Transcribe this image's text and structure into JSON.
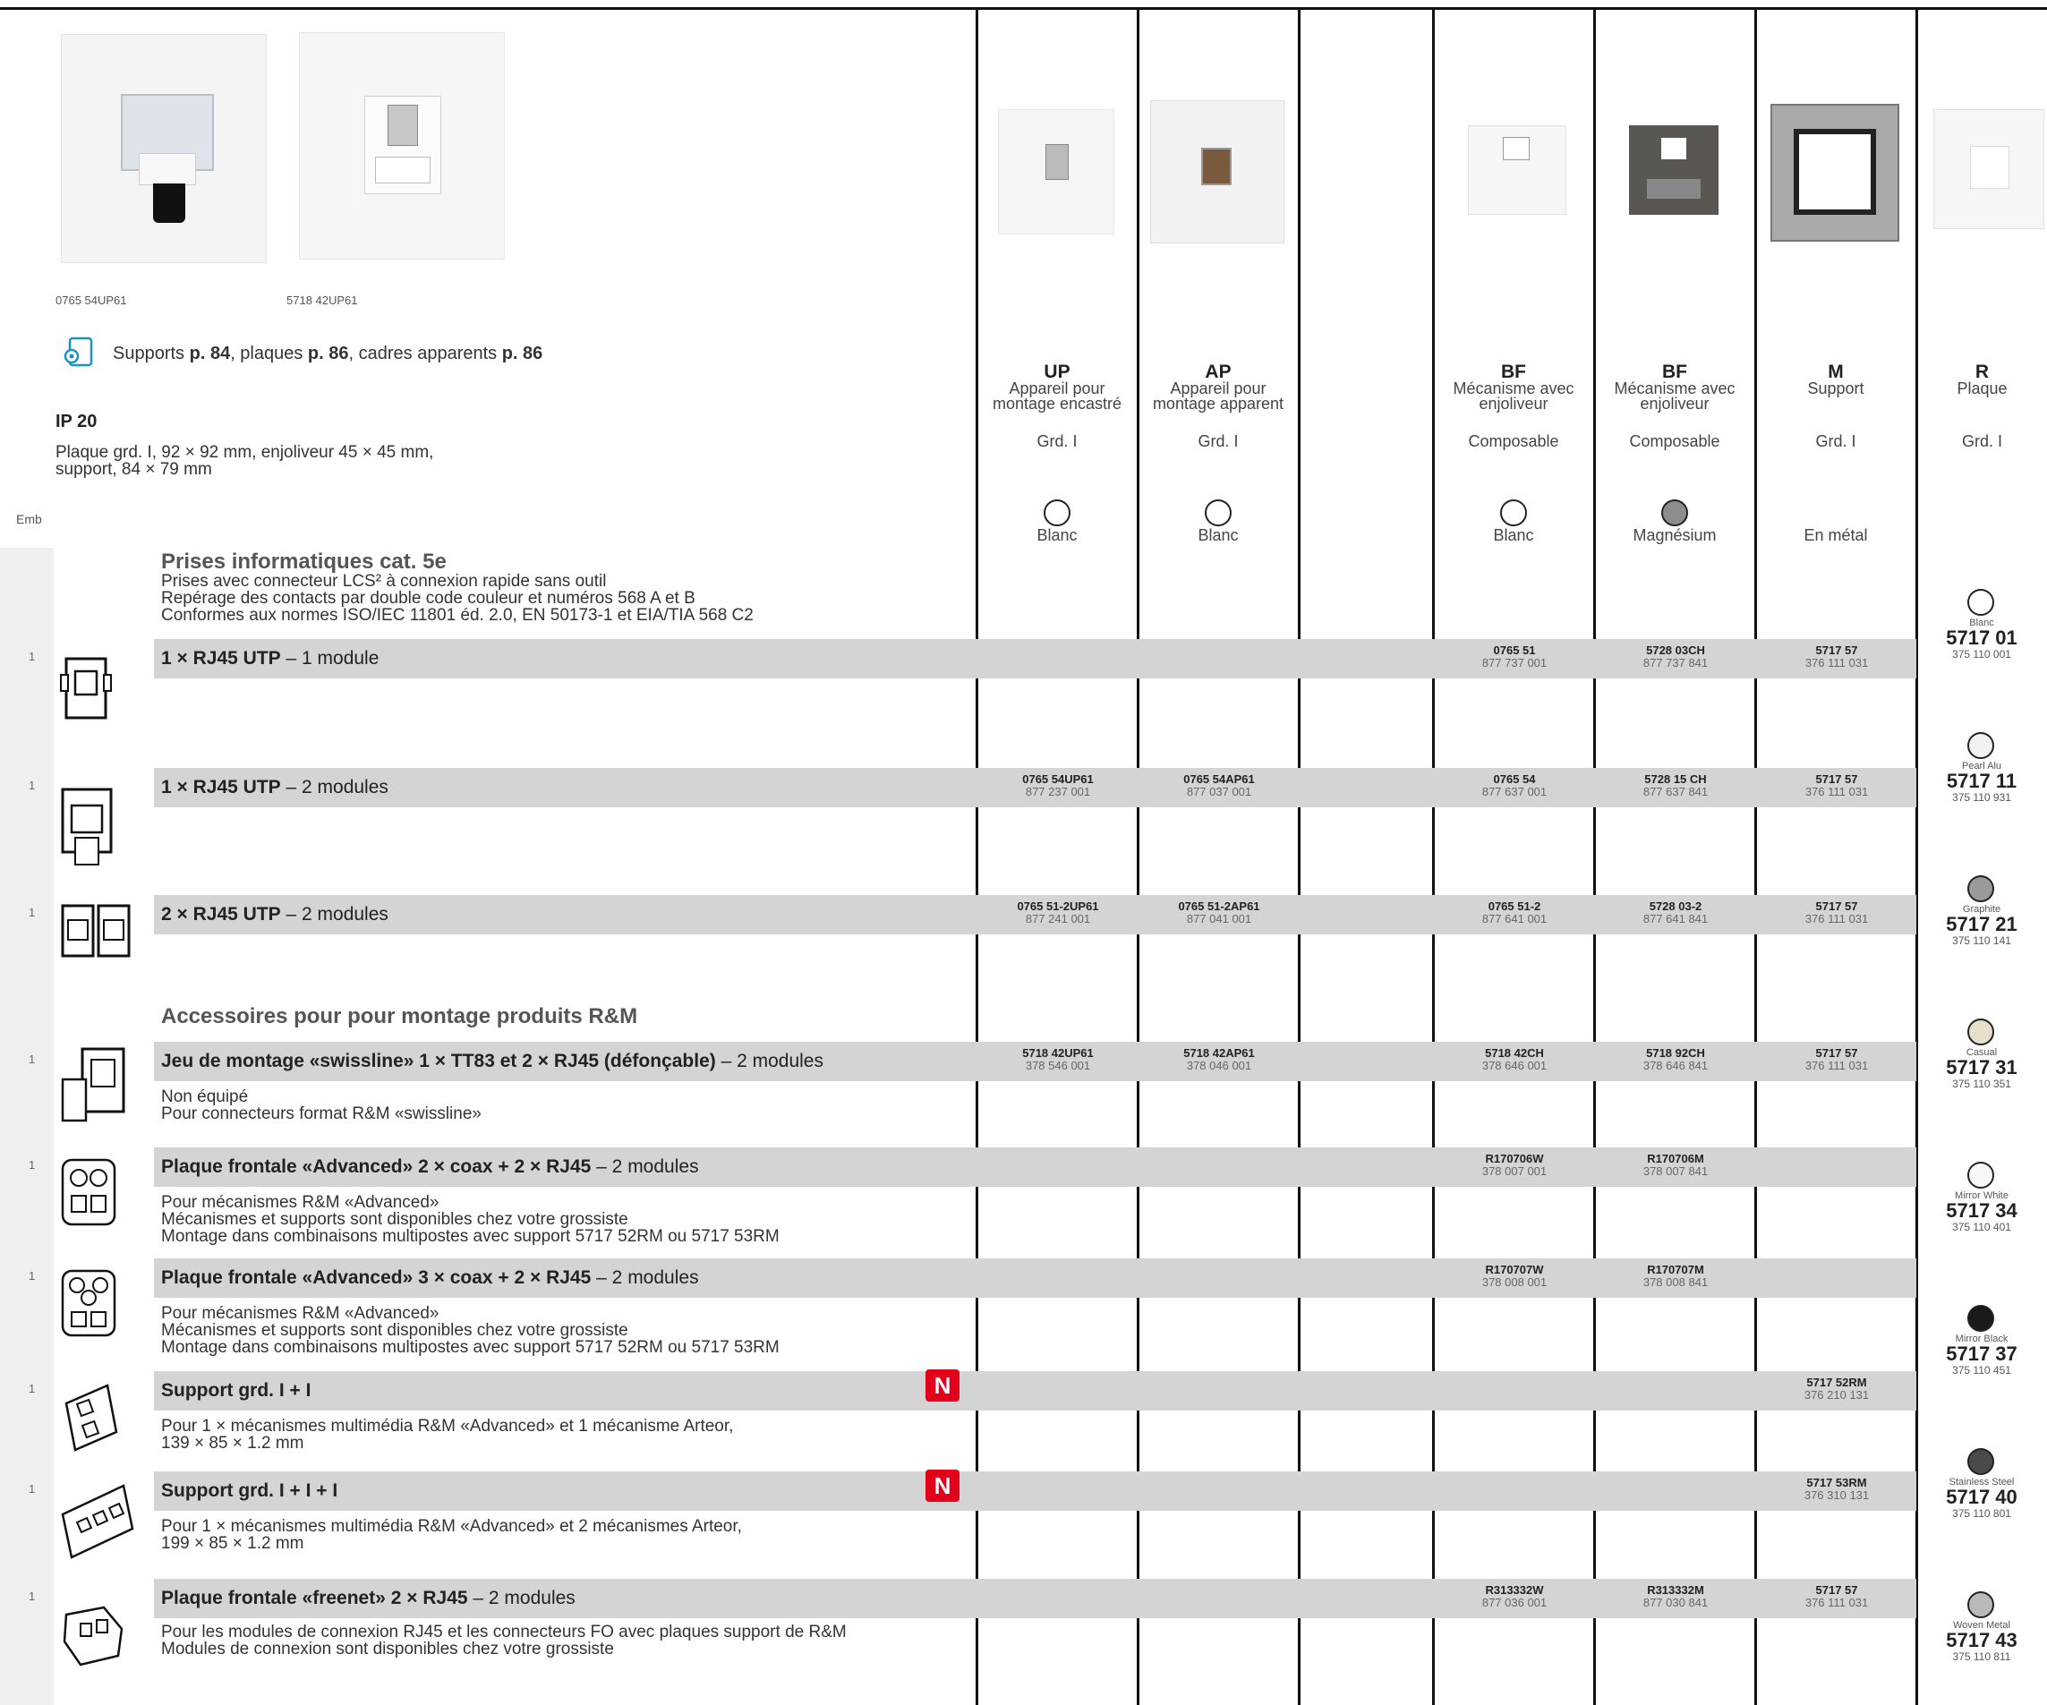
{
  "header": {
    "photo_caption_1": "0765 54UP61",
    "photo_caption_2": "5718 42UP61",
    "links": {
      "pre": "Supports ",
      "p1": "p. 84",
      "mid1": ", plaques ",
      "p2": "p. 86",
      "mid2": ", cadres apparents ",
      "p3": "p. 86"
    },
    "ip": "IP 20",
    "dims": "Plaque grd. I, 92 × 92 mm, enjoliveur 45 × 45 mm,\nsupport, 84 × 79 mm",
    "emb": "Emb"
  },
  "columns": [
    {
      "key": "UP",
      "desc": "Appareil pour\nmontage encastré",
      "sub": "Grd. I",
      "color": "Blanc"
    },
    {
      "key": "AP",
      "desc": "Appareil pour\nmontage apparent",
      "sub": "Grd. I",
      "color": "Blanc"
    },
    {
      "key": "BF",
      "desc": "Mécanisme avec\nenjoliveur",
      "sub": "Composable",
      "color": "Blanc"
    },
    {
      "key": "BF",
      "desc": "Mécanisme avec\nenjoliveur",
      "sub": "Composable",
      "color": "Magnésium"
    },
    {
      "key": "M",
      "desc": "Support",
      "sub": "Grd. I",
      "color": "En métal"
    },
    {
      "key": "R",
      "desc": "Plaque",
      "sub": "Grd. I"
    }
  ],
  "section1": {
    "title": "Prises informatiques cat. 5e",
    "desc": "Prises avec connecteur LCS² à connexion rapide sans outil\nRepérage des contacts par double code couleur et numéros 568 A et B\nConformes aux normes ISO/IEC 11801 éd. 2.0, EN 50173-1 et EIA/TIA 568 C2"
  },
  "section2": {
    "title": "Accessoires pour pour montage produits R&M"
  },
  "rows": [
    {
      "emb": "1",
      "bold": "1 × RJ45 UTP",
      "rest": " – 1 module",
      "desc": "",
      "up": [
        "",
        ""
      ],
      "ap": [
        "",
        ""
      ],
      "bfw": [
        "0765 51",
        "877 737 001"
      ],
      "bfm": [
        "5728 03CH",
        "877 737 841"
      ],
      "m": [
        "5717 57",
        "376 111 031"
      ]
    },
    {
      "emb": "1",
      "bold": "1 × RJ45 UTP",
      "rest": " – 2 modules",
      "desc": "",
      "up": [
        "0765 54UP61",
        "877 237 001"
      ],
      "ap": [
        "0765 54AP61",
        "877 037 001"
      ],
      "bfw": [
        "0765 54",
        "877 637 001"
      ],
      "bfm": [
        "5728 15 CH",
        "877 637 841"
      ],
      "m": [
        "5717 57",
        "376 111 031"
      ]
    },
    {
      "emb": "1",
      "bold": "2 × RJ45 UTP",
      "rest": " – 2 modules",
      "desc": "",
      "up": [
        "0765 51-2UP61",
        "877 241 001"
      ],
      "ap": [
        "0765 51-2AP61",
        "877 041 001"
      ],
      "bfw": [
        "0765 51-2",
        "877 641 001"
      ],
      "bfm": [
        "5728 03-2",
        "877 641 841"
      ],
      "m": [
        "5717 57",
        "376 111 031"
      ]
    },
    {
      "emb": "1",
      "bold": "Jeu de montage «swissline» 1 × TT83 et 2 × RJ45 (défonçable)",
      "rest": " – 2 modules",
      "desc": "Non équipé\nPour connecteurs format R&M «swissline»",
      "up": [
        "5718 42UP61",
        "378 546 001"
      ],
      "ap": [
        "5718 42AP61",
        "378 046 001"
      ],
      "bfw": [
        "5718 42CH",
        "378 646 001"
      ],
      "bfm": [
        "5718 92CH",
        "378 646 841"
      ],
      "m": [
        "5717 57",
        "376 111 031"
      ]
    },
    {
      "emb": "1",
      "bold": "Plaque frontale «Advanced» 2 × coax + 2 × RJ45",
      "rest": " – 2 modules",
      "desc": "Pour mécanismes R&M  «Advanced»\nMécanismes et supports sont disponibles chez votre grossiste\nMontage dans combinaisons multipostes avec support 5717 52RM ou 5717 53RM",
      "up": [
        "",
        ""
      ],
      "ap": [
        "",
        ""
      ],
      "bfw": [
        "R170706W",
        "378 007 001"
      ],
      "bfm": [
        "R170706M",
        "378 007 841"
      ],
      "m": [
        "",
        ""
      ]
    },
    {
      "emb": "1",
      "bold": "Plaque frontale «Advanced» 3 × coax + 2 × RJ45",
      "rest": " – 2 modules",
      "desc": "Pour mécanismes R&M  «Advanced»\nMécanismes et supports sont disponibles chez votre grossiste\nMontage dans combinaisons multipostes avec support 5717 52RM ou 5717 53RM",
      "up": [
        "",
        ""
      ],
      "ap": [
        "",
        ""
      ],
      "bfw": [
        "R170707W",
        "378 008 001"
      ],
      "bfm": [
        "R170707M",
        "378 008 841"
      ],
      "m": [
        "",
        ""
      ]
    },
    {
      "emb": "1",
      "bold": "Support grd. I + I",
      "rest": "",
      "badge": "N",
      "desc": "Pour 1 × mécanismes multimédia R&M «Advanced» et 1 mécanisme Arteor,\n139 × 85 × 1.2 mm",
      "up": [
        "",
        ""
      ],
      "ap": [
        "",
        ""
      ],
      "bfw": [
        "",
        ""
      ],
      "bfm": [
        "",
        ""
      ],
      "m": [
        "5717 52RM",
        "376 210 131"
      ]
    },
    {
      "emb": "1",
      "bold": "Support grd. I + I + I",
      "rest": "",
      "badge": "N",
      "desc": "Pour 1 × mécanismes multimédia R&M «Advanced» et 2 mécanismes Arteor,\n199 × 85 × 1.2 mm",
      "up": [
        "",
        ""
      ],
      "ap": [
        "",
        ""
      ],
      "bfw": [
        "",
        ""
      ],
      "bfm": [
        "",
        ""
      ],
      "m": [
        "5717 53RM",
        "376 310 131"
      ]
    },
    {
      "emb": "1",
      "bold": "Plaque frontale «freenet» 2 × RJ45",
      "rest": " – 2 modules",
      "desc": "Pour les modules de connexion RJ45 et les connecteurs FO avec plaques support de R&M\nModules de connexion sont disponibles chez votre grossiste",
      "up": [
        "",
        ""
      ],
      "ap": [
        "",
        ""
      ],
      "bfw": [
        "R313332W",
        "877 036 001"
      ],
      "bfm": [
        "R313332M",
        "877 030 841"
      ],
      "m": [
        "5717 57",
        "376 111 031"
      ]
    }
  ],
  "plates": [
    {
      "name": "Blanc",
      "code": "5717 01",
      "ean": "375 110 001",
      "color": "#ffffff"
    },
    {
      "name": "Pearl Alu",
      "code": "5717 11",
      "ean": "375 110 931",
      "color": "#f2f2f2"
    },
    {
      "name": "Graphite",
      "code": "5717 21",
      "ean": "375 110 141",
      "color": "#9a9a9a"
    },
    {
      "name": "Casual",
      "code": "5717 31",
      "ean": "375 110 351",
      "color": "#e6dfcc"
    },
    {
      "name": "Mirror White",
      "code": "5717 34",
      "ean": "375 110 401",
      "color": "#f7f7f7"
    },
    {
      "name": "Mirror Black",
      "code": "5717 37",
      "ean": "375 110 451",
      "color": "#1a1a1a"
    },
    {
      "name": "Stainless Steel",
      "code": "5717 40",
      "ean": "375 110 801",
      "color": "#4a4a4a"
    },
    {
      "name": "Woven Metal",
      "code": "5717 43",
      "ean": "375 110 811",
      "color": "#b9b9b9"
    }
  ],
  "colors": {
    "grey_band": "#d4d4d4",
    "badge": "#e2001a",
    "magnesium": "#8d8d8d"
  }
}
